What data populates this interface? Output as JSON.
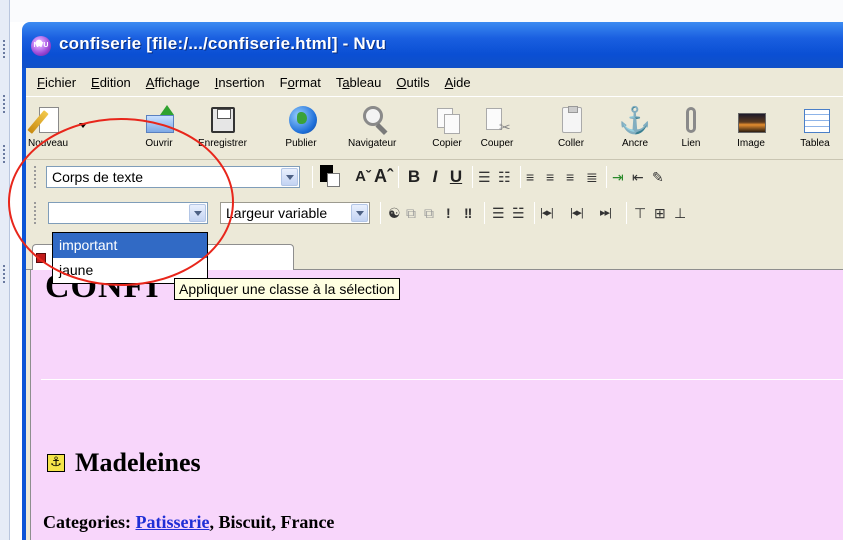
{
  "window": {
    "title": "confiserie [file:/.../confiserie.html] - Nvu",
    "app_icon_text": "NVU",
    "titlebar_color": "#0a4fd4"
  },
  "menu": [
    "Fichier",
    "Edition",
    "Affichage",
    "Insertion",
    "Format",
    "Tableau",
    "Outils",
    "Aide"
  ],
  "menu_accel": [
    "F",
    "E",
    "A",
    "I",
    "o",
    "a",
    "O",
    "A"
  ],
  "toolbar": {
    "nouveau": "Nouveau",
    "ouvrir": "Ouvrir",
    "enregistrer": "Enregistrer",
    "publier": "Publier",
    "navigateur": "Navigateur",
    "copier": "Copier",
    "couper": "Couper",
    "coller": "Coller",
    "ancre": "Ancre",
    "lien": "Lien",
    "image": "Image",
    "tableau": "Tablea"
  },
  "format1": {
    "paragraph_style": "Corps de texte",
    "text_color": "#000000",
    "font_smaller": "Aˇ",
    "font_larger": "Aˆ",
    "bold": "B",
    "italic": "I",
    "underline": "U"
  },
  "format2": {
    "class_value": "",
    "font_face": "Largeur variable"
  },
  "class_dropdown": {
    "options": [
      "important",
      "jaune"
    ],
    "selected_index": 0,
    "selected_color": "#316ac5"
  },
  "tooltip": "Appliquer une classe à la sélection",
  "document": {
    "heading": "CONFI",
    "section_title": "Madeleines",
    "categories_label": "Categories: ",
    "categories_link": "Patisserie",
    "categories_rest": ", Biscuit, France",
    "background": "#f8d6fb"
  },
  "annotation": {
    "color": "#e8261b"
  }
}
